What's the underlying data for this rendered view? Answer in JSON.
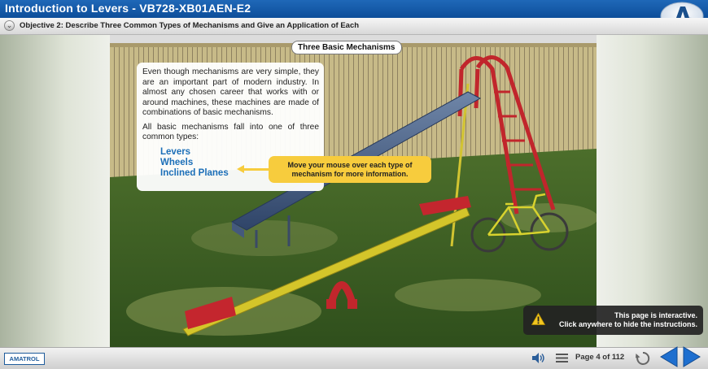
{
  "header": {
    "title": "Introduction to Levers - VB728-XB01AEN-E2",
    "objective": "Objective 2: Describe Three Common Types of Mechanisms and Give an Application of Each",
    "logo_letter": "A"
  },
  "scene": {
    "title": "Three Basic Mechanisms",
    "paragraph1": "Even though mechanisms are very simple, they are an important part of modern industry. In almost any chosen career that works with or around machines, these machines are made of combinations of basic mechanisms.",
    "paragraph2": "All basic mechanisms fall into one of three common types:",
    "links": [
      "Levers",
      "Wheels",
      "Inclined Planes"
    ],
    "callout": "Move your mouse over each type of mechanism for more information."
  },
  "instructions": {
    "line1": "This page is interactive.",
    "line2": "Click anywhere to hide the instructions."
  },
  "footer": {
    "brand": "AMATROL",
    "page_label": "Page 4 of 112"
  },
  "icons": {
    "chevron": "chevron-down-icon",
    "warning": "warning-icon",
    "audio": "speaker-icon",
    "menu": "menu-icon",
    "replay": "replay-icon",
    "back": "back-arrow-icon",
    "next": "next-arrow-icon"
  },
  "colors": {
    "title_bar": "#1565b5",
    "link": "#1c6fb8",
    "callout": "#f7cc3d",
    "nav_arrow": "#1e6fcf"
  }
}
